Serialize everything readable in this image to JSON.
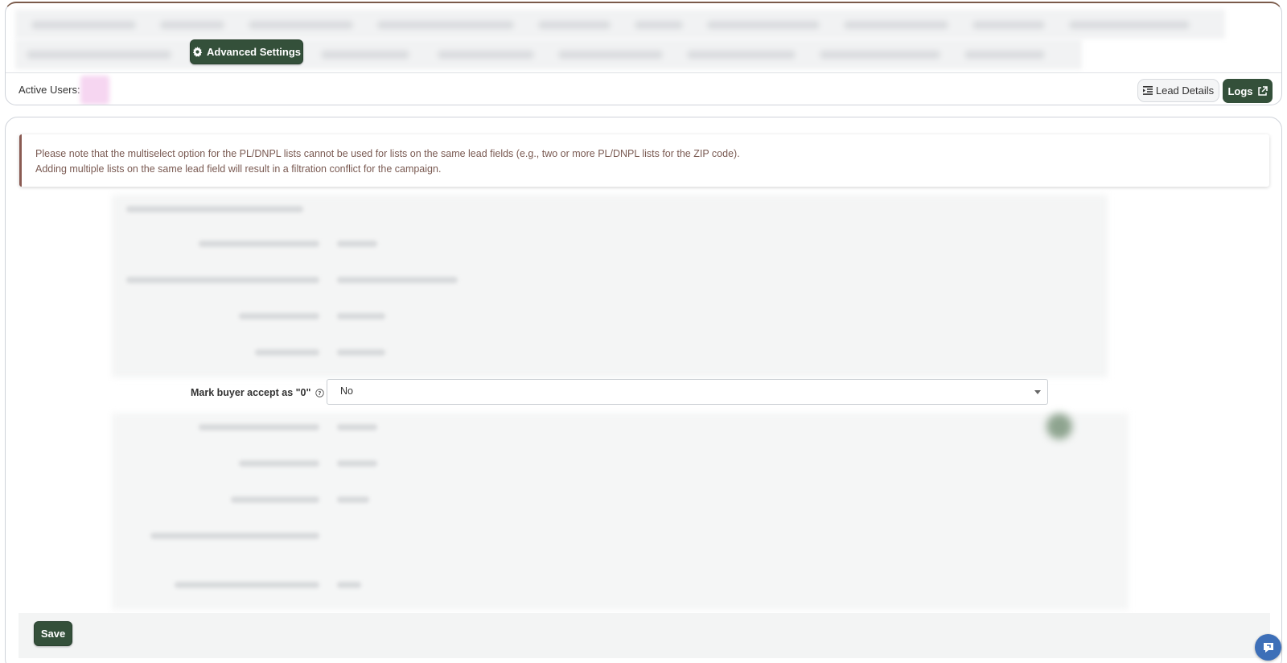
{
  "top_nav": {
    "advanced_settings_label": "Advanced Settings",
    "active_users_label": "Active Users:",
    "lead_details_label": "Lead Details",
    "logs_label": "Logs"
  },
  "notice": {
    "line1": "Please note that the multiselect option for the PL/DNPL lists cannot be used for lists on the same lead fields (e.g., two or more PL/DNPL lists for the ZIP code).",
    "line2": "Adding multiple lists on the same lead field will result in a filtration conflict for the campaign."
  },
  "form": {
    "mark_buyer_accept": {
      "label": "Mark buyer accept as \"0\"",
      "value": "No"
    }
  },
  "footer": {
    "save_label": "Save"
  },
  "colors": {
    "primary": "#34503a",
    "notice_border": "#8a5a52",
    "notice_text": "#7a5a52",
    "chat_widget": "#3d6fb8"
  }
}
